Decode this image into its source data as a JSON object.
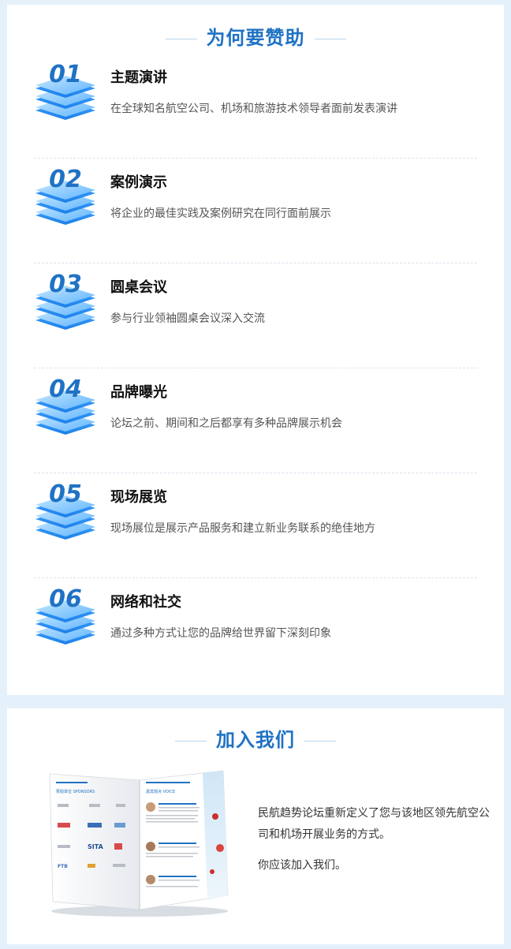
{
  "why": {
    "title": "为何要赞助",
    "items": [
      {
        "number": "01",
        "title": "主题演讲",
        "desc": "在全球知名航空公司、机场和旅游技术领导者面前发表演讲"
      },
      {
        "number": "02",
        "title": "案例演示",
        "desc": "将企业的最佳实践及案例研究在同行面前展示"
      },
      {
        "number": "03",
        "title": "圆桌会议",
        "desc": "参与行业领袖圆桌会议深入交流"
      },
      {
        "number": "04",
        "title": "品牌曝光",
        "desc": "论坛之前、期间和之后都享有多种品牌展示机会"
      },
      {
        "number": "05",
        "title": "现场展览",
        "desc": "现场展位是展示产品服务和建立新业务联系的绝佳地方"
      },
      {
        "number": "06",
        "title": "网络和社交",
        "desc": "通过多种方式让您的品牌给世界留下深刻印象"
      }
    ]
  },
  "join": {
    "title": "加入我们",
    "paragraph1": "民航趋势论坛重新定义了您与该地区领先航空公司和机场开展业务的方式。",
    "paragraph2": "你应该加入我们。",
    "brochure": {
      "left_heading": "赞助单位 SPONSORS",
      "right_heading": "嘉宾观点 VOICE",
      "logo_sita": "SITA",
      "logo_ftb": "FTB"
    }
  },
  "colors": {
    "accent": "#1f72c4",
    "page_bg": "#e4f1fb",
    "badge_light": "#9fd4ff",
    "badge_dark": "#1d8fff"
  }
}
